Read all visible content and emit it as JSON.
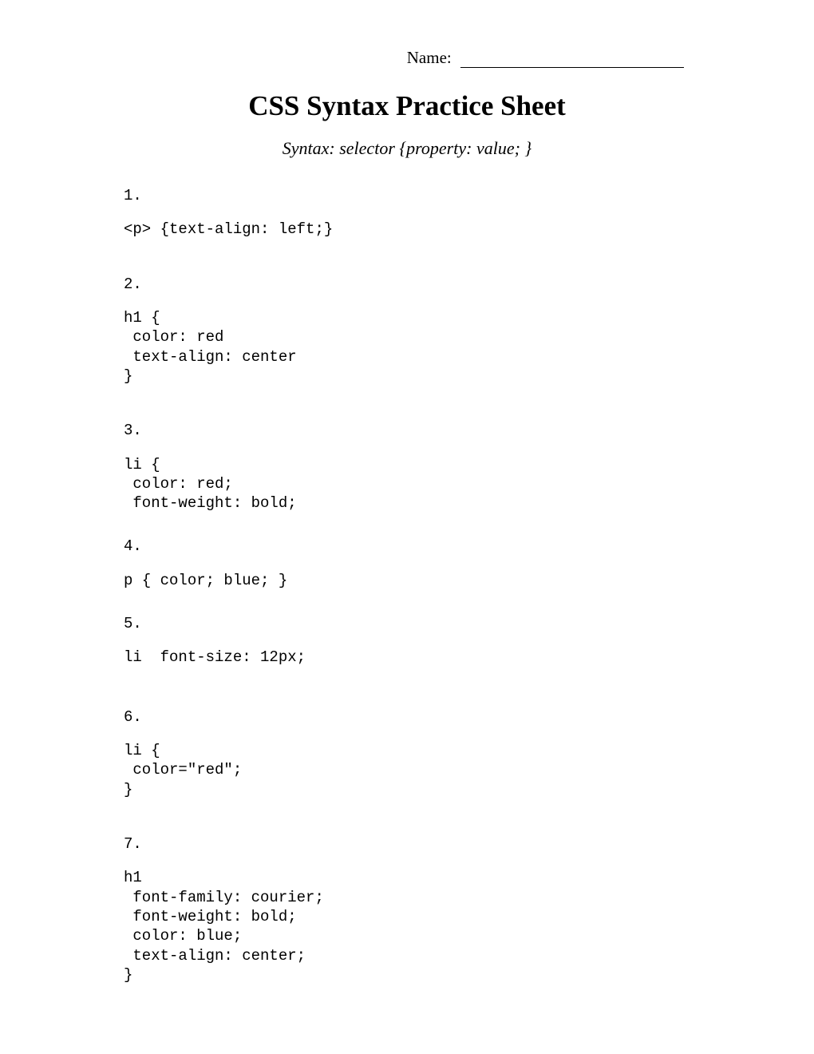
{
  "header": {
    "name_label": "Name:"
  },
  "title": "CSS Syntax Practice Sheet",
  "syntax_hint": "Syntax:  selector {property: value; }",
  "questions": [
    {
      "num": "1.",
      "code": "<p> {text-align: left;}"
    },
    {
      "num": "2.",
      "code": "h1 {\n color: red\n text-align: center\n}"
    },
    {
      "num": "3.",
      "code": "li {\n color: red;\n font-weight: bold;"
    },
    {
      "num": "4.",
      "code": "p { color; blue; }"
    },
    {
      "num": "5.",
      "code": "li  font-size: 12px;"
    },
    {
      "num": "6.",
      "code": "li {\n color=\"red\";\n}"
    },
    {
      "num": "7.",
      "code": "h1\n font-family: courier;\n font-weight: bold;\n color: blue;\n text-align: center;\n}"
    }
  ]
}
